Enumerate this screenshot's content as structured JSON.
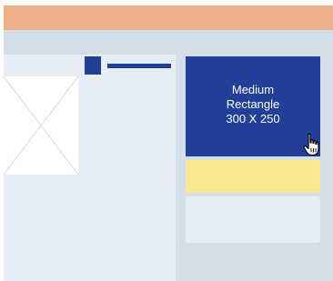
{
  "ad_slot": {
    "line1": "Medium",
    "line2": "Rectangle",
    "line3": "300 X 250"
  },
  "colors": {
    "header_bar": "#ebb087",
    "background": "#d3dee8",
    "content_panel": "#e6edf5",
    "ad_fill": "#22409a",
    "highlight_bar": "#fee792"
  },
  "icons": {
    "cursor": "hand-pointer-icon",
    "image": "image-placeholder-icon"
  }
}
